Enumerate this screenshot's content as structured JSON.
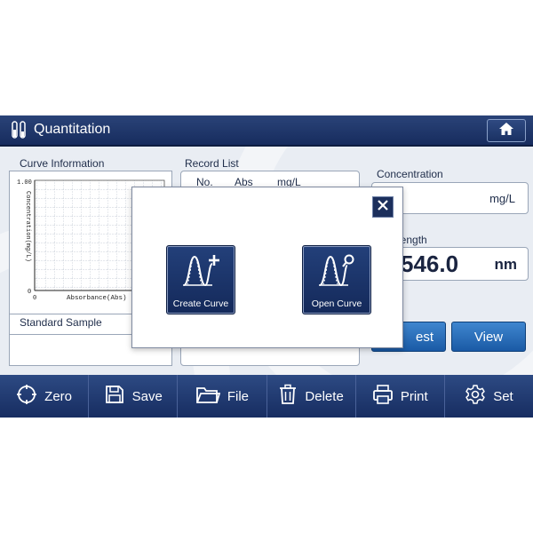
{
  "window": {
    "title": "Quantitation"
  },
  "curve_info": {
    "label": "Curve Information",
    "y_axis_label": "Concentration(mg/L)",
    "x_axis_label": "Absorbance(Abs)",
    "y_max_tick": "1.00",
    "origin_tick": "0",
    "x_origin_tick": "0"
  },
  "standard_sample": {
    "label": "Standard Sample"
  },
  "record_list": {
    "label": "Record List",
    "columns": [
      "No.",
      "Abs",
      "mg/L"
    ]
  },
  "concentration": {
    "label": "Concentration",
    "unit": "mg/L"
  },
  "wavelength": {
    "label_visible": "length",
    "value_visible": "546.0",
    "unit": "nm"
  },
  "buttons": {
    "test_visible": "est",
    "view": "View"
  },
  "toolbar": {
    "zero": "Zero",
    "save": "Save",
    "file": "File",
    "delete": "Delete",
    "print": "Print",
    "set": "Set"
  },
  "dialog": {
    "create_curve": "Create Curve",
    "open_curve": "Open Curve"
  }
}
